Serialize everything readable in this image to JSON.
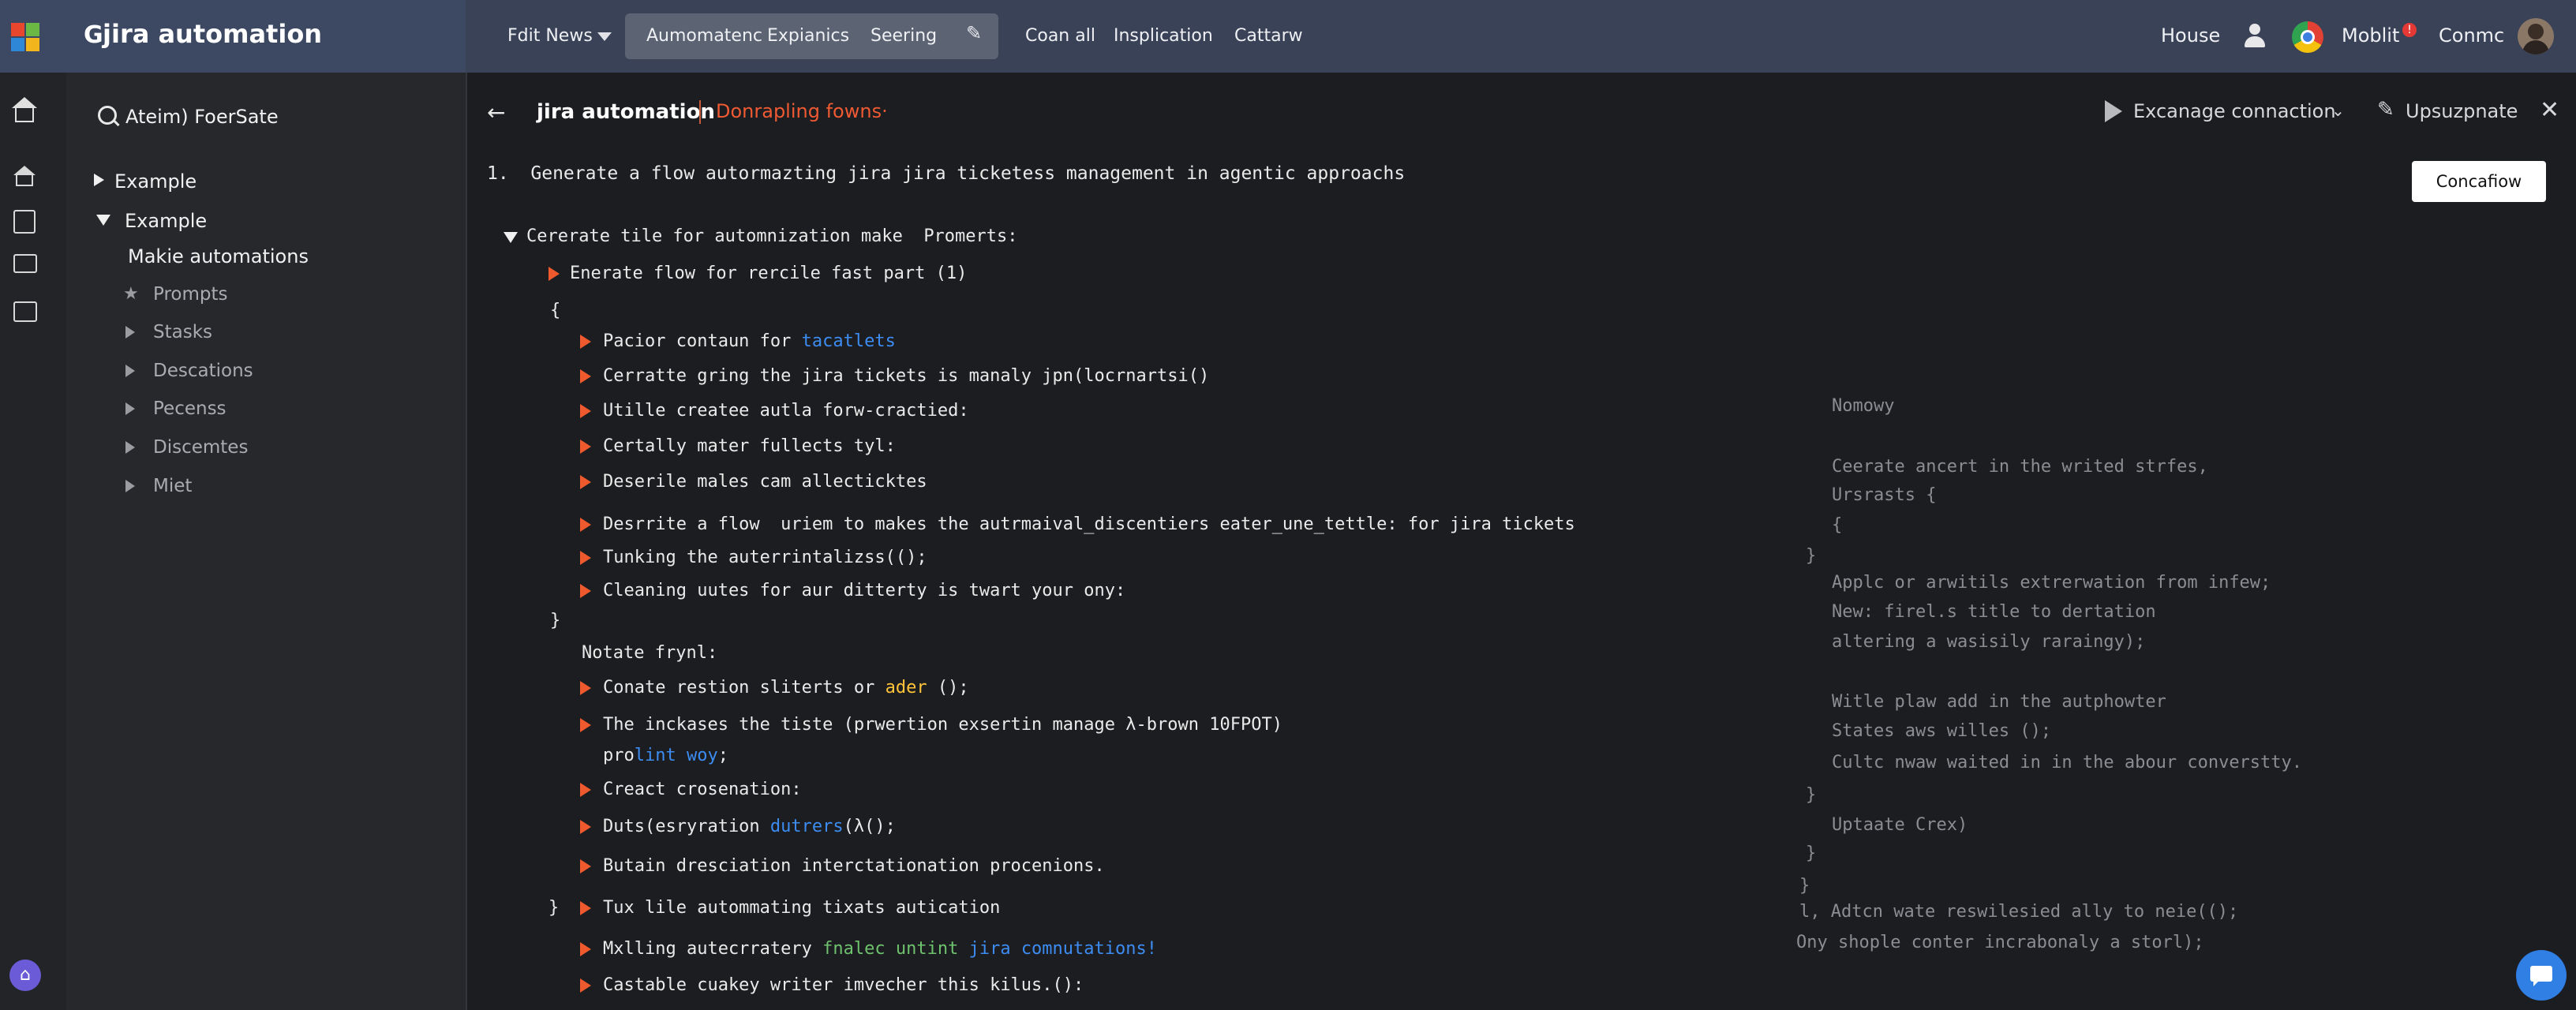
{
  "app": {
    "title": "jira automation"
  },
  "topbar": {
    "menu_left": "Fdit News",
    "tabs": [
      "Aumomatenc",
      "Expianics",
      "Seering"
    ],
    "links": [
      "Coan all",
      "Insplication",
      "Cattarw"
    ],
    "right": {
      "house": "House",
      "mobile": "Moblit",
      "badge": "!",
      "conmc": "Conmc"
    }
  },
  "sidebar": {
    "search": "Ateim) FoerSate",
    "items": [
      {
        "label": "Example",
        "expanded": false
      },
      {
        "label": "Example",
        "expanded": true
      }
    ],
    "heading": "Makie automations",
    "sub": [
      "Prompts",
      "Stasks",
      "Descations",
      "Pecenss",
      "Discemtes",
      "Miet"
    ]
  },
  "header": {
    "title": "jira automation",
    "subtitle": "Donrapling fowns·",
    "connection": "Excanage connaction",
    "update": "Upsuzpnate",
    "action_button": "Concafiow"
  },
  "prompt": "1.  Generate a flow autormazting jira jira ticketess management in agentic approachs",
  "tree": {
    "root": "Cererate tile for automnization make  Promerts:",
    "l1": "Enerate flow for rercile fast part (1)",
    "open_brace": "{",
    "close_brace": "}",
    "items_a": [
      {
        "text": "Pacior contaun for ",
        "hl": "tacatlets",
        "hl_class": "blue",
        "tail": ""
      },
      {
        "text": "Cerratte gring the jira tickets is manaly jpn(locrnartsi()",
        "hl": "",
        "hl_class": "",
        "tail": ""
      },
      {
        "text": "Utille createe autla forw-cractied:",
        "hl": "",
        "hl_class": "",
        "tail": ""
      },
      {
        "text": "Certally mater fullects tyl:",
        "hl": "",
        "hl_class": "",
        "tail": ""
      },
      {
        "text": "Deserile males cam allecticktes",
        "hl": "",
        "hl_class": "",
        "tail": ""
      },
      {
        "text": "Desrrite a flow  uriem to makes the autrmaival_discentiers eater_une_tettle: for jira tickets",
        "hl": "",
        "hl_class": "",
        "tail": ""
      },
      {
        "text": "Tunking the auterrintalizss(();",
        "hl": "",
        "hl_class": "",
        "tail": ""
      },
      {
        "text": "Cleaning uutes for aur ditterty is twart your ony:",
        "hl": "",
        "hl_class": "",
        "tail": ""
      }
    ],
    "notate": "Notate frynl:",
    "items_b": [
      {
        "text": "Conate restion sliterts or ",
        "hl": "ader",
        "hl_class": "yellow",
        "tail": " ();"
      },
      {
        "text": "The inckases the tiste (prwertion exsertin manage λ-brown 10FPOT)",
        "hl": "",
        "hl_class": "",
        "tail": ""
      }
    ],
    "proline": {
      "a": "pro",
      "b": "lint woy",
      "c": ";"
    },
    "items_c": [
      {
        "text": "Creact crosenation:",
        "hl": "",
        "hl_class": "",
        "tail": ""
      },
      {
        "text": "Duts(esryration ",
        "hl": "dutrers",
        "hl_class": "blue",
        "tail": "(λ();"
      },
      {
        "text": "Butain dresciation interctationation procenions.",
        "hl": "",
        "hl_class": "",
        "tail": ""
      },
      {
        "text": "Tux lile autommating tixats autication",
        "hl": "",
        "hl_class": "",
        "tail": ""
      }
    ],
    "mailing": {
      "a": "Mxlling autecrratery ",
      "b": "fnalec untint",
      "c": " jira comnutations!"
    },
    "castable": "Castable cuakey writer imvecher this kilus.():"
  },
  "faint_panel": [
    "Nomowy",
    "Ceerate ancert in the writed strfes,",
    "Ursrasts {",
    "{",
    "}",
    "Applc or arwitils extrerwation from infew;",
    "New: firel.s title to dertation",
    "altering a wasisily raraingy);",
    "Witle plaw add in the autphowter",
    "States aws willes ();",
    "Cultc nwaw waited in in the abour converstty.",
    "}",
    "Uptaate Crex)",
    "}",
    "}",
    "l, Adtcn wate reswilesied ally to neie(();",
    "Ony shople conter incrabonaly a storl);"
  ],
  "colors": {
    "accent_orange": "#ee5a2d",
    "link_blue": "#3d8cf2",
    "hl_yellow": "#ffc43a",
    "purple": "#6b5bd6"
  }
}
